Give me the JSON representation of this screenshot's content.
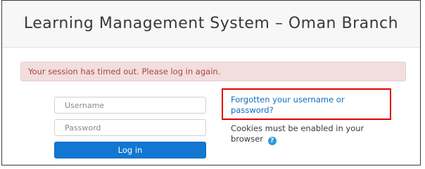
{
  "header": {
    "title": "Learning Management System – Oman Branch"
  },
  "alert": {
    "message": "Your session has timed out. Please log in again."
  },
  "login_form": {
    "username_placeholder": "Username",
    "password_placeholder": "Password",
    "login_label": "Log in"
  },
  "side": {
    "forgot_link": "Forgotten your username or password?",
    "cookies_text": "Cookies must be enabled in your browser",
    "help_icon_glyph": "?",
    "help_icon": "help-circle-icon"
  },
  "colors": {
    "accent": "#0f6cbf",
    "button": "#1177d1",
    "alert_bg": "#f2dede",
    "alert_text": "#a94442",
    "highlight_border": "#e00000"
  }
}
